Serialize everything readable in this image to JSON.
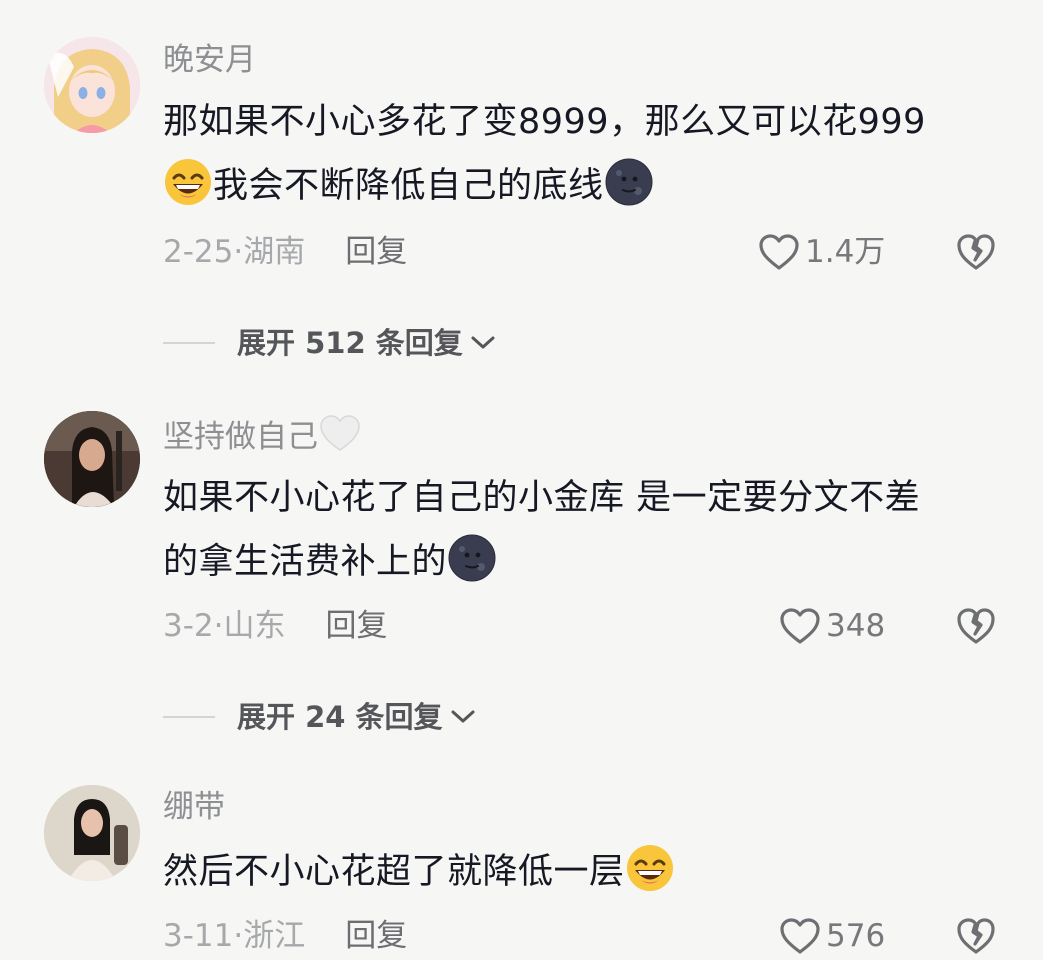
{
  "comments": [
    {
      "username": "晚安月",
      "text_line1": "那如果不小心多花了变8999，那么又可以花999",
      "text_line2": "我会不断降低自己的底线",
      "date_location": "2-25·湖南",
      "reply_label": "回复",
      "likes": "1.4万",
      "expand_label": "展开 512 条回复"
    },
    {
      "username": "坚持做自己",
      "text_line1": "如果不小心花了自己的小金库 是一定要分文不差",
      "text_line2": "的拿生活费补上的",
      "date_location": "3-2·山东",
      "reply_label": "回复",
      "likes": "348",
      "expand_label": "展开 24 条回复"
    },
    {
      "username": "绷带",
      "text_line1": "然后不小心花超了就降低一层",
      "date_location": "3-11·浙江",
      "reply_label": "回复",
      "likes": "576"
    }
  ],
  "icons": {
    "like": "heart-outline-icon",
    "dislike": "broken-heart-icon",
    "expand": "chevron-down-icon",
    "emoji_grin": "grinning-sweat-emoji",
    "emoji_moon": "new-moon-face-emoji",
    "emoji_heart": "white-heart-emoji"
  },
  "colors": {
    "background": "#f6f6f5",
    "text": "#161823",
    "secondary": "#8e8f93"
  }
}
